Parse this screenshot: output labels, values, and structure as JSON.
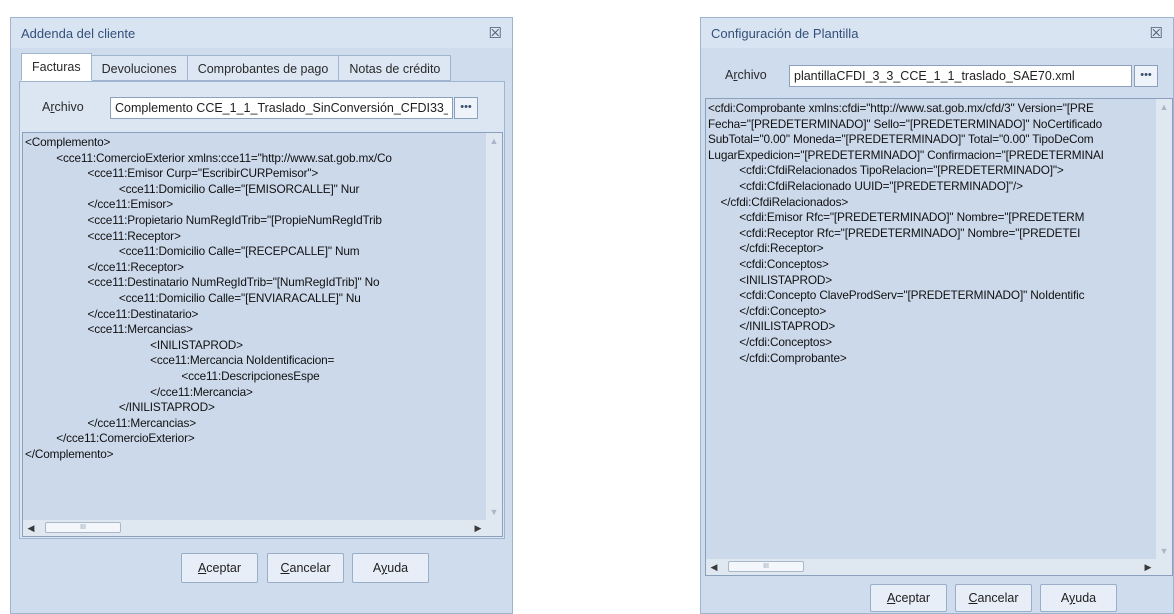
{
  "left_dialog": {
    "title": "Addenda del cliente",
    "tabs": [
      {
        "label": "Facturas",
        "active": true
      },
      {
        "label": "Devoluciones",
        "active": false
      },
      {
        "label": "Comprobantes de pago",
        "active": false
      },
      {
        "label": "Notas de crédito",
        "active": false
      }
    ],
    "archivo_label_pre": "A",
    "archivo_label_u": "r",
    "archivo_label_post": "chivo",
    "archivo_value": "Complemento CCE_1_1_Traslado_SinConversión_CFDI33_",
    "browse_label": "•••",
    "code_lines": [
      "<Complemento>",
      "          <cce11:ComercioExterior xmlns:cce11=\"http://www.sat.gob.mx/Co",
      "                    <cce11:Emisor Curp=\"EscribirCURPemisor\">",
      "                              <cce11:Domicilio Calle=\"[EMISORCALLE]\" Nur",
      "                    </cce11:Emisor>",
      "                    <cce11:Propietario NumRegIdTrib=\"[PropieNumRegIdTrib",
      "                    <cce11:Receptor>",
      "                              <cce11:Domicilio Calle=\"[RECEPCALLE]\" Num",
      "                    </cce11:Receptor>",
      "                    <cce11:Destinatario NumRegIdTrib=\"[NumRegIdTrib]\" No",
      "                              <cce11:Domicilio Calle=\"[ENVIARACALLE]\" Nu",
      "                    </cce11:Destinatario>",
      "                    <cce11:Mercancias>",
      "                                        <INILISTAPROD>",
      "                                        <cce11:Mercancia NoIdentificacion=",
      "                                                  <cce11:DescripcionesEspe",
      "                                        </cce11:Mercancia>",
      "                              </INILISTAPROD>",
      "                    </cce11:Mercancias>",
      "          </cce11:ComercioExterior>",
      "</Complemento>"
    ],
    "thumb_grip": "III",
    "buttons": {
      "accept_u": "A",
      "accept_rest": "ceptar",
      "cancel_u": "C",
      "cancel_rest": "ancelar",
      "help_pre": "A",
      "help_u": "y",
      "help_rest": "uda"
    }
  },
  "right_dialog": {
    "title": "Configuración de Plantilla",
    "archivo_label_pre": "A",
    "archivo_label_u": "r",
    "archivo_label_post": "chivo",
    "archivo_value": "plantillaCFDI_3_3_CCE_1_1_traslado_SAE70.xml",
    "browse_label": "•••",
    "code_lines": [
      "<cfdi:Comprobante xmlns:cfdi=\"http://www.sat.gob.mx/cfd/3\" Version=\"[PRE",
      "Fecha=\"[PREDETERMINADO]\" Sello=\"[PREDETERMINADO]\" NoCertificado",
      "SubTotal=\"0.00\" Moneda=\"[PREDETERMINADO]\" Total=\"0.00\" TipoDeCom",
      "LugarExpedicion=\"[PREDETERMINADO]\" Confirmacion=\"[PREDETERMINAI",
      "          <cfdi:CfdiRelacionados TipoRelacion=\"[PREDETERMINADO]\">",
      "          <cfdi:CfdiRelacionado UUID=\"[PREDETERMINADO]\"/>",
      "    </cfdi:CfdiRelacionados>",
      "          <cfdi:Emisor Rfc=\"[PREDETERMINADO]\" Nombre=\"[PREDETERM",
      "          <cfdi:Receptor Rfc=\"[PREDETERMINADO]\" Nombre=\"[PREDETEI",
      "          </cfdi:Receptor>",
      "          <cfdi:Conceptos>",
      "          <INILISTAPROD>",
      "          <cfdi:Concepto ClaveProdServ=\"[PREDETERMINADO]\" NoIdentific",
      "          </cfdi:Concepto>",
      "          </INILISTAPROD>",
      "          </cfdi:Conceptos>",
      "          </cfdi:Comprobante>"
    ],
    "thumb_grip": "III",
    "buttons": {
      "accept_u": "A",
      "accept_rest": "ceptar",
      "cancel_u": "C",
      "cancel_rest": "ancelar",
      "help_pre": "A",
      "help_u": "y",
      "help_rest": "uda"
    }
  },
  "close_glyph": "☒"
}
